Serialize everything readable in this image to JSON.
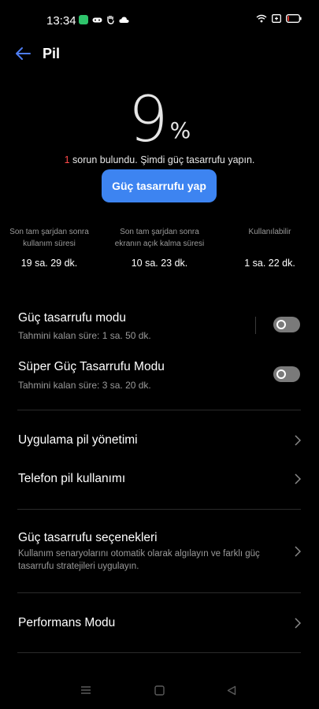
{
  "status_bar": {
    "time": "13:34",
    "notification_icons": [
      "chat-app-icon",
      "game-controller-icon",
      "hand-icon",
      "cloud-icon"
    ],
    "right_icons": [
      "wifi-icon",
      "sim-icon",
      "battery-icon"
    ]
  },
  "header": {
    "title": "Pil"
  },
  "battery": {
    "percent": "9",
    "percent_sign": "%",
    "level": 0.09,
    "issue_count": "1",
    "issue_text": " sorun bulundu. Şimdi güç tasarrufu yapın.",
    "save_button_label": "Güç tasarrufu yap"
  },
  "stats": [
    {
      "label_line1": "Son tam şarjdan sonra",
      "label_line2": "kullanım süresi",
      "value": "19 sa. 29 dk."
    },
    {
      "label_line1": "Son tam şarjdan sonra",
      "label_line2": "ekranın açık kalma süresi",
      "value": "10 sa. 23 dk."
    },
    {
      "label_line1": "Kullanılabilir",
      "label_line2": "",
      "value": "1 sa. 22 dk."
    }
  ],
  "settings": {
    "power_saving": {
      "title": "Güç tasarrufu modu",
      "subtitle": "Tahmini kalan süre:  1 sa. 50 dk.",
      "enabled": false
    },
    "super_power_saving": {
      "title": "Süper Güç Tasarrufu Modu",
      "subtitle": "Tahmini kalan süre:  3 sa. 20 dk.",
      "enabled": false
    },
    "app_battery_management": {
      "title": "Uygulama pil yönetimi"
    },
    "phone_battery_usage": {
      "title": "Telefon pil kullanımı"
    },
    "power_saving_options": {
      "title": "Güç tasarrufu seçenekleri",
      "subtitle_line1": "Kullanım senaryolarını otomatik olarak algılayın ve farklı güç",
      "subtitle_line2": "tasarrufu stratejileri uygulayın."
    },
    "performance_mode": {
      "title": "Performans Modu"
    }
  },
  "nav_bar": {
    "buttons": [
      "menu-icon",
      "home-square-icon",
      "back-triangle-icon"
    ]
  }
}
